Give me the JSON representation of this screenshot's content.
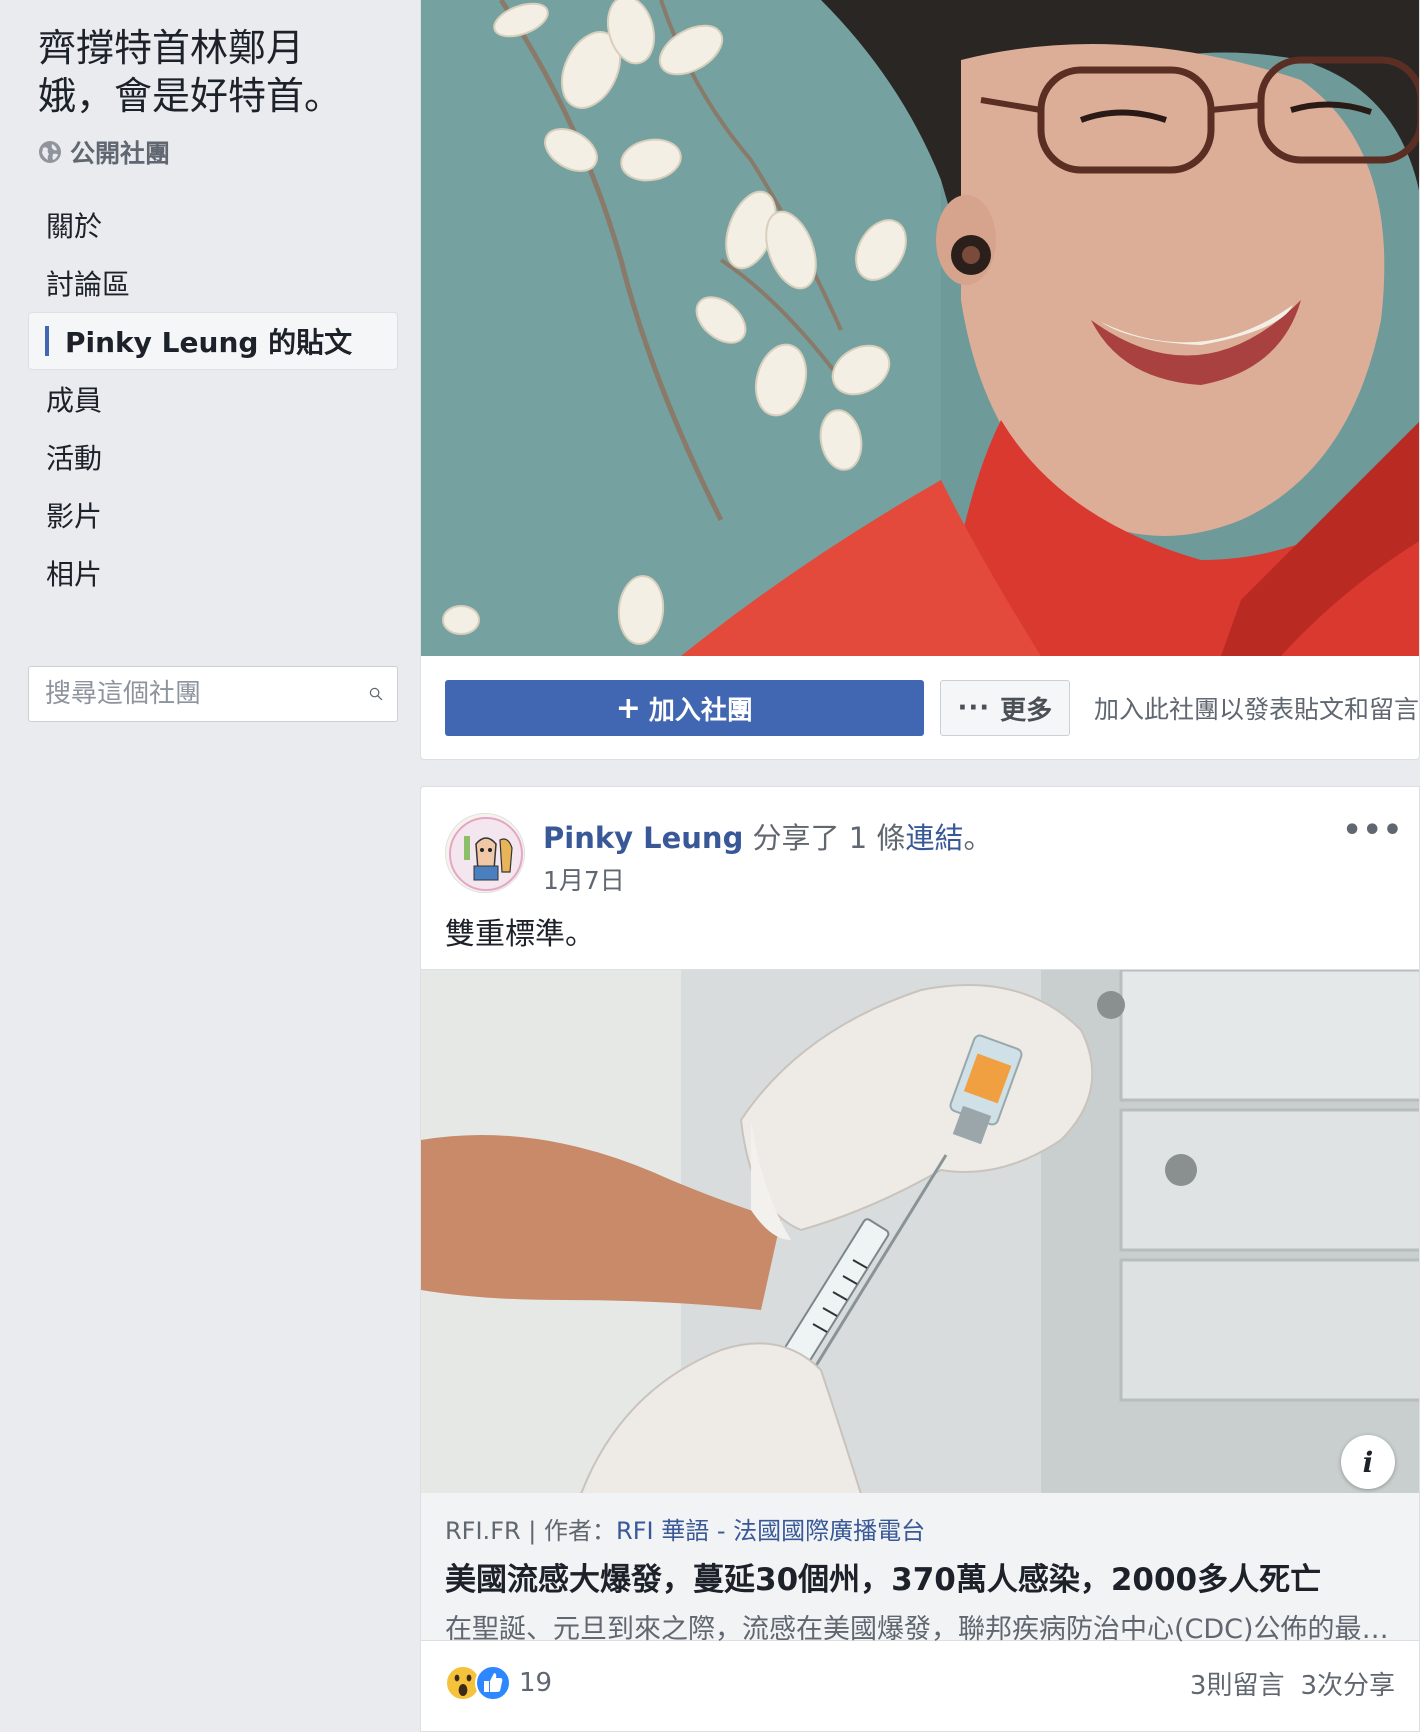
{
  "group": {
    "title": "齊撐特首林鄭月娥，會是好特首。",
    "privacy": "公開社團"
  },
  "nav": {
    "items": [
      {
        "label": "關於"
      },
      {
        "label": "討論區"
      },
      {
        "label": "Pinky Leung 的貼文"
      },
      {
        "label": "成員"
      },
      {
        "label": "活動"
      },
      {
        "label": "影片"
      },
      {
        "label": "相片"
      }
    ],
    "active_index": 2
  },
  "search": {
    "placeholder": "搜尋這個社團"
  },
  "cover": {
    "join_label": "加入社團",
    "more_label": "更多",
    "join_hint": "加入此社團以發表貼文和留言"
  },
  "post": {
    "author": "Pinky Leung",
    "action_prefix": " 分享了 1 條",
    "action_link": "連結",
    "action_suffix": "。",
    "date": "1月7日",
    "text": "雙重標準。",
    "link": {
      "source": "RFI.FR",
      "byline_label": "作者：",
      "byline_author": "RFI 華語 - 法國國際廣播電台",
      "title": "美國流感大爆發，蔓延30個州，370萬人感染，2000多人死亡",
      "description": "在聖誕、元旦到來之際，流感在美國爆發，聯邦疾病防治中心(CDC)公佈的最新數據"
    },
    "reactions": {
      "icons": [
        "wow-reaction-icon",
        "like-reaction-icon"
      ],
      "count": "19"
    },
    "comments": "3則留言",
    "shares": "3次分享"
  },
  "colors": {
    "brand_blue": "#4267b2",
    "link_blue": "#385898",
    "page_bg": "#e9ebee"
  }
}
